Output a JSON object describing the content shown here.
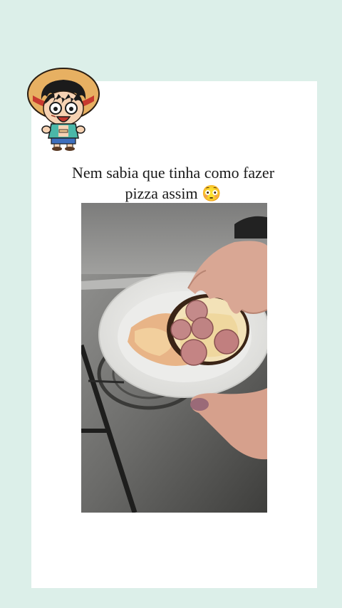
{
  "post": {
    "caption_line1": "Nem sabia que tinha como fazer",
    "caption_line2": "pizza assim 😳",
    "sticker_icon": "straw-hat-pirate-sticker",
    "media_icon": "pizza-on-paper-plate-photo"
  },
  "colors": {
    "background": "#dcefe9",
    "card": "#ffffff",
    "caption_text": "#1a1a1a"
  }
}
